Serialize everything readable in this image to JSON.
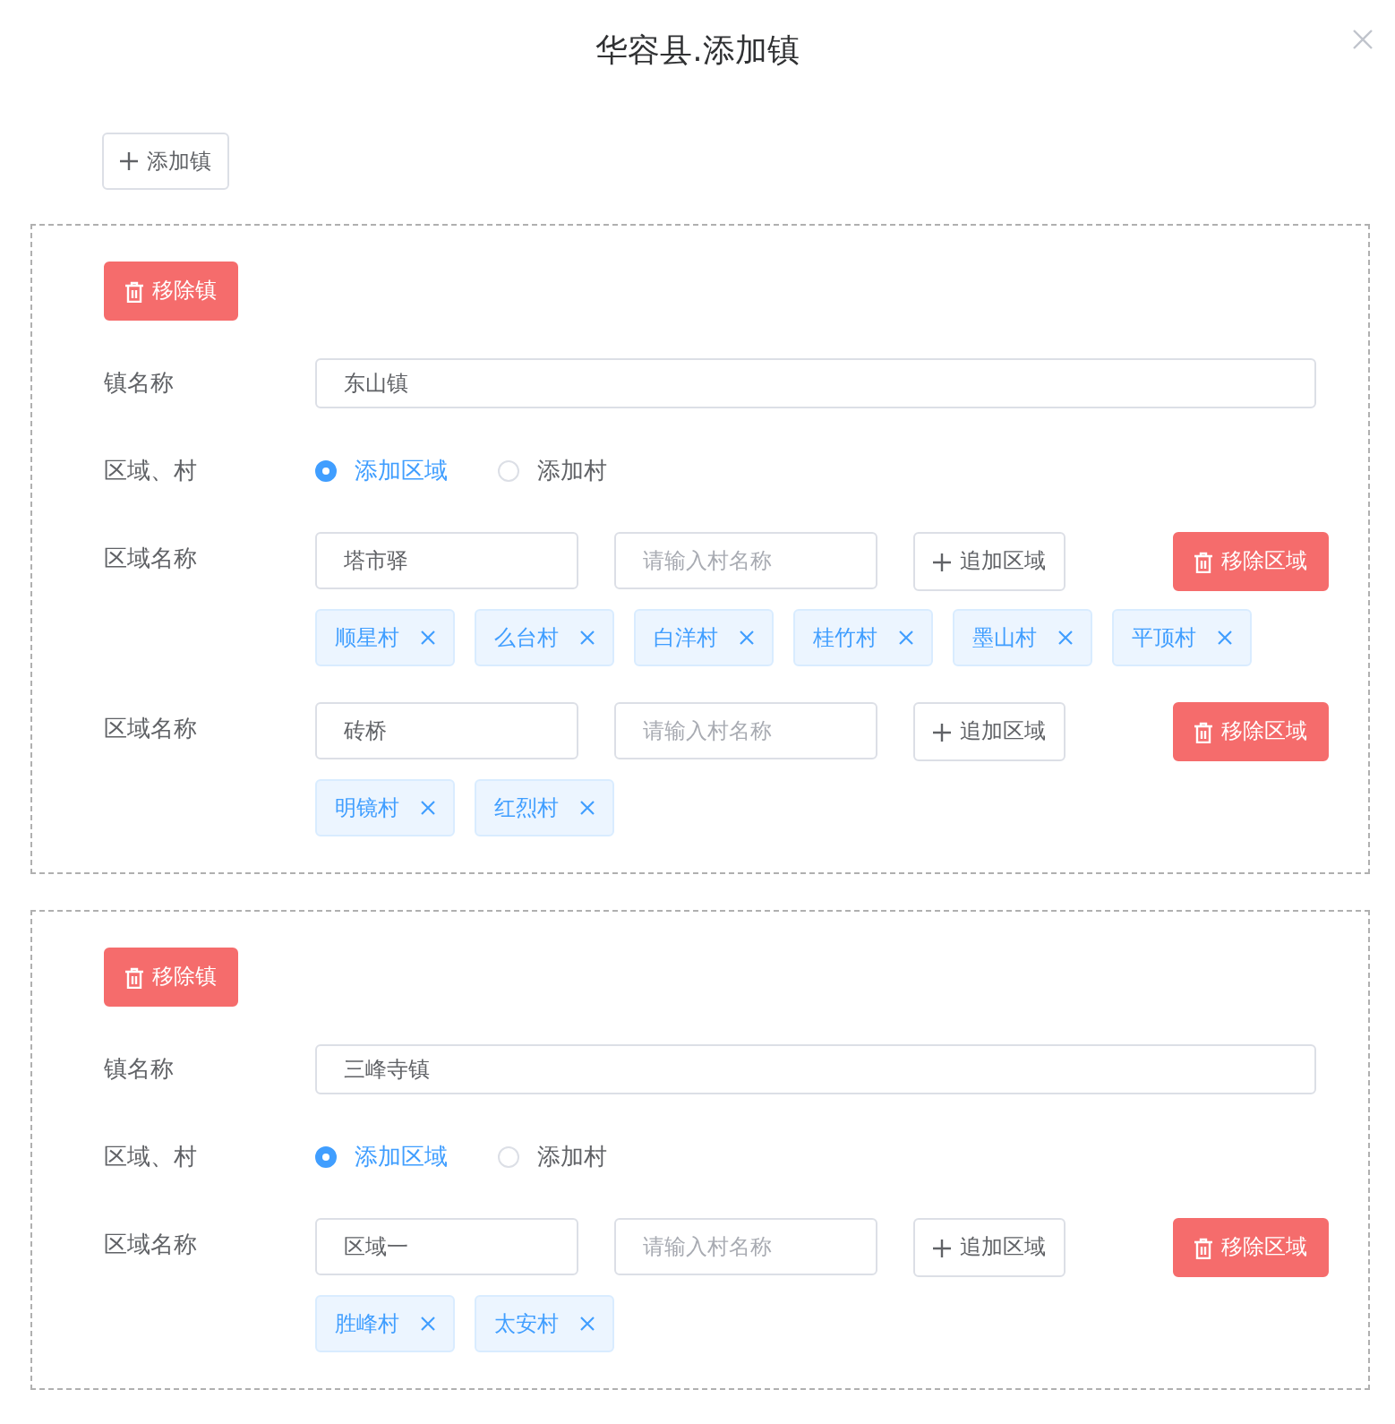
{
  "dialog": {
    "title": "华容县.添加镇"
  },
  "add_town_button": "添加镇",
  "towns": [
    {
      "remove_label": "移除镇",
      "name_label": "镇名称",
      "name_value": "东山镇",
      "mode_label": "区域、村",
      "options": [
        {
          "label": "添加区域",
          "selected": true
        },
        {
          "label": "添加村",
          "selected": false
        }
      ],
      "regions": [
        {
          "label": "区域名称",
          "name": "塔市驿",
          "village_placeholder": "请输入村名称",
          "add_label": "追加区域",
          "remove_label": "移除区域",
          "villages": [
            "顺星村",
            "么台村",
            "白洋村",
            "桂竹村",
            "墨山村",
            "平顶村"
          ]
        },
        {
          "label": "区域名称",
          "name": "砖桥",
          "village_placeholder": "请输入村名称",
          "add_label": "追加区域",
          "remove_label": "移除区域",
          "villages": [
            "明镜村",
            "红烈村"
          ]
        }
      ]
    },
    {
      "remove_label": "移除镇",
      "name_label": "镇名称",
      "name_value": "三峰寺镇",
      "mode_label": "区域、村",
      "options": [
        {
          "label": "添加区域",
          "selected": true
        },
        {
          "label": "添加村",
          "selected": false
        }
      ],
      "regions": [
        {
          "label": "区域名称",
          "name": "区域一",
          "village_placeholder": "请输入村名称",
          "add_label": "追加区域",
          "remove_label": "移除区域",
          "villages": [
            "胜峰村",
            "太安村"
          ]
        }
      ]
    }
  ]
}
